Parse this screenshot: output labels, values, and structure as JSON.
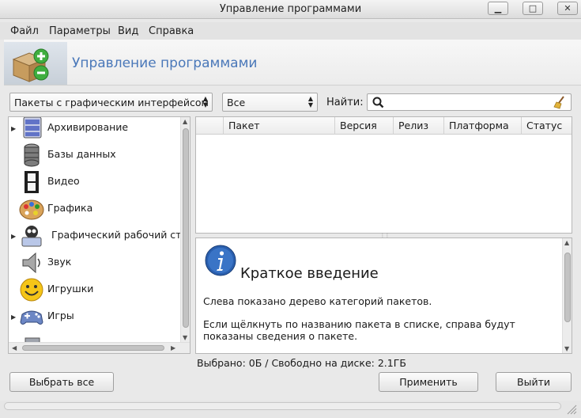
{
  "window": {
    "title": "Управление программами",
    "controls": [
      "minimize-icon",
      "maximize-icon",
      "close-icon"
    ]
  },
  "menu": [
    "Файл",
    "Параметры",
    "Вид",
    "Справка"
  ],
  "header": {
    "title": "Управление программами"
  },
  "filters": {
    "package_type": "Пакеты с графическим интерфейсом",
    "status": "Все",
    "find_label": "Найти:",
    "search_value": ""
  },
  "categories": [
    {
      "label": "Архивирование",
      "expandable": true,
      "icon": "archive-icon"
    },
    {
      "label": "Базы данных",
      "expandable": false,
      "icon": "database-icon"
    },
    {
      "label": "Видео",
      "expandable": false,
      "icon": "video-icon"
    },
    {
      "label": "Графика",
      "expandable": false,
      "icon": "palette-icon"
    },
    {
      "label": "Графический рабочий стол",
      "expandable": true,
      "icon": "desktop-icon"
    },
    {
      "label": "Звук",
      "expandable": false,
      "icon": "speaker-icon"
    },
    {
      "label": "Игрушки",
      "expandable": false,
      "icon": "smiley-icon"
    },
    {
      "label": "Игры",
      "expandable": true,
      "icon": "gamepad-icon"
    }
  ],
  "table": {
    "columns": [
      "Пакет",
      "Версия",
      "Релиз",
      "Платформа",
      "Статус"
    ],
    "rows": []
  },
  "info": {
    "heading": "Краткое введение",
    "paragraph1": "Слева показано дерево категорий пакетов.",
    "paragraph2": "Если щёлкнуть по названию пакета в списке, справа будут показаны сведения о пакете."
  },
  "status_text": "Выбрано: 0Б / Свободно на диске: 2.1ГБ",
  "buttons": {
    "select_all": "Выбрать все",
    "apply": "Применить",
    "quit": "Выйти"
  },
  "colors": {
    "accent": "#4a78b9"
  }
}
